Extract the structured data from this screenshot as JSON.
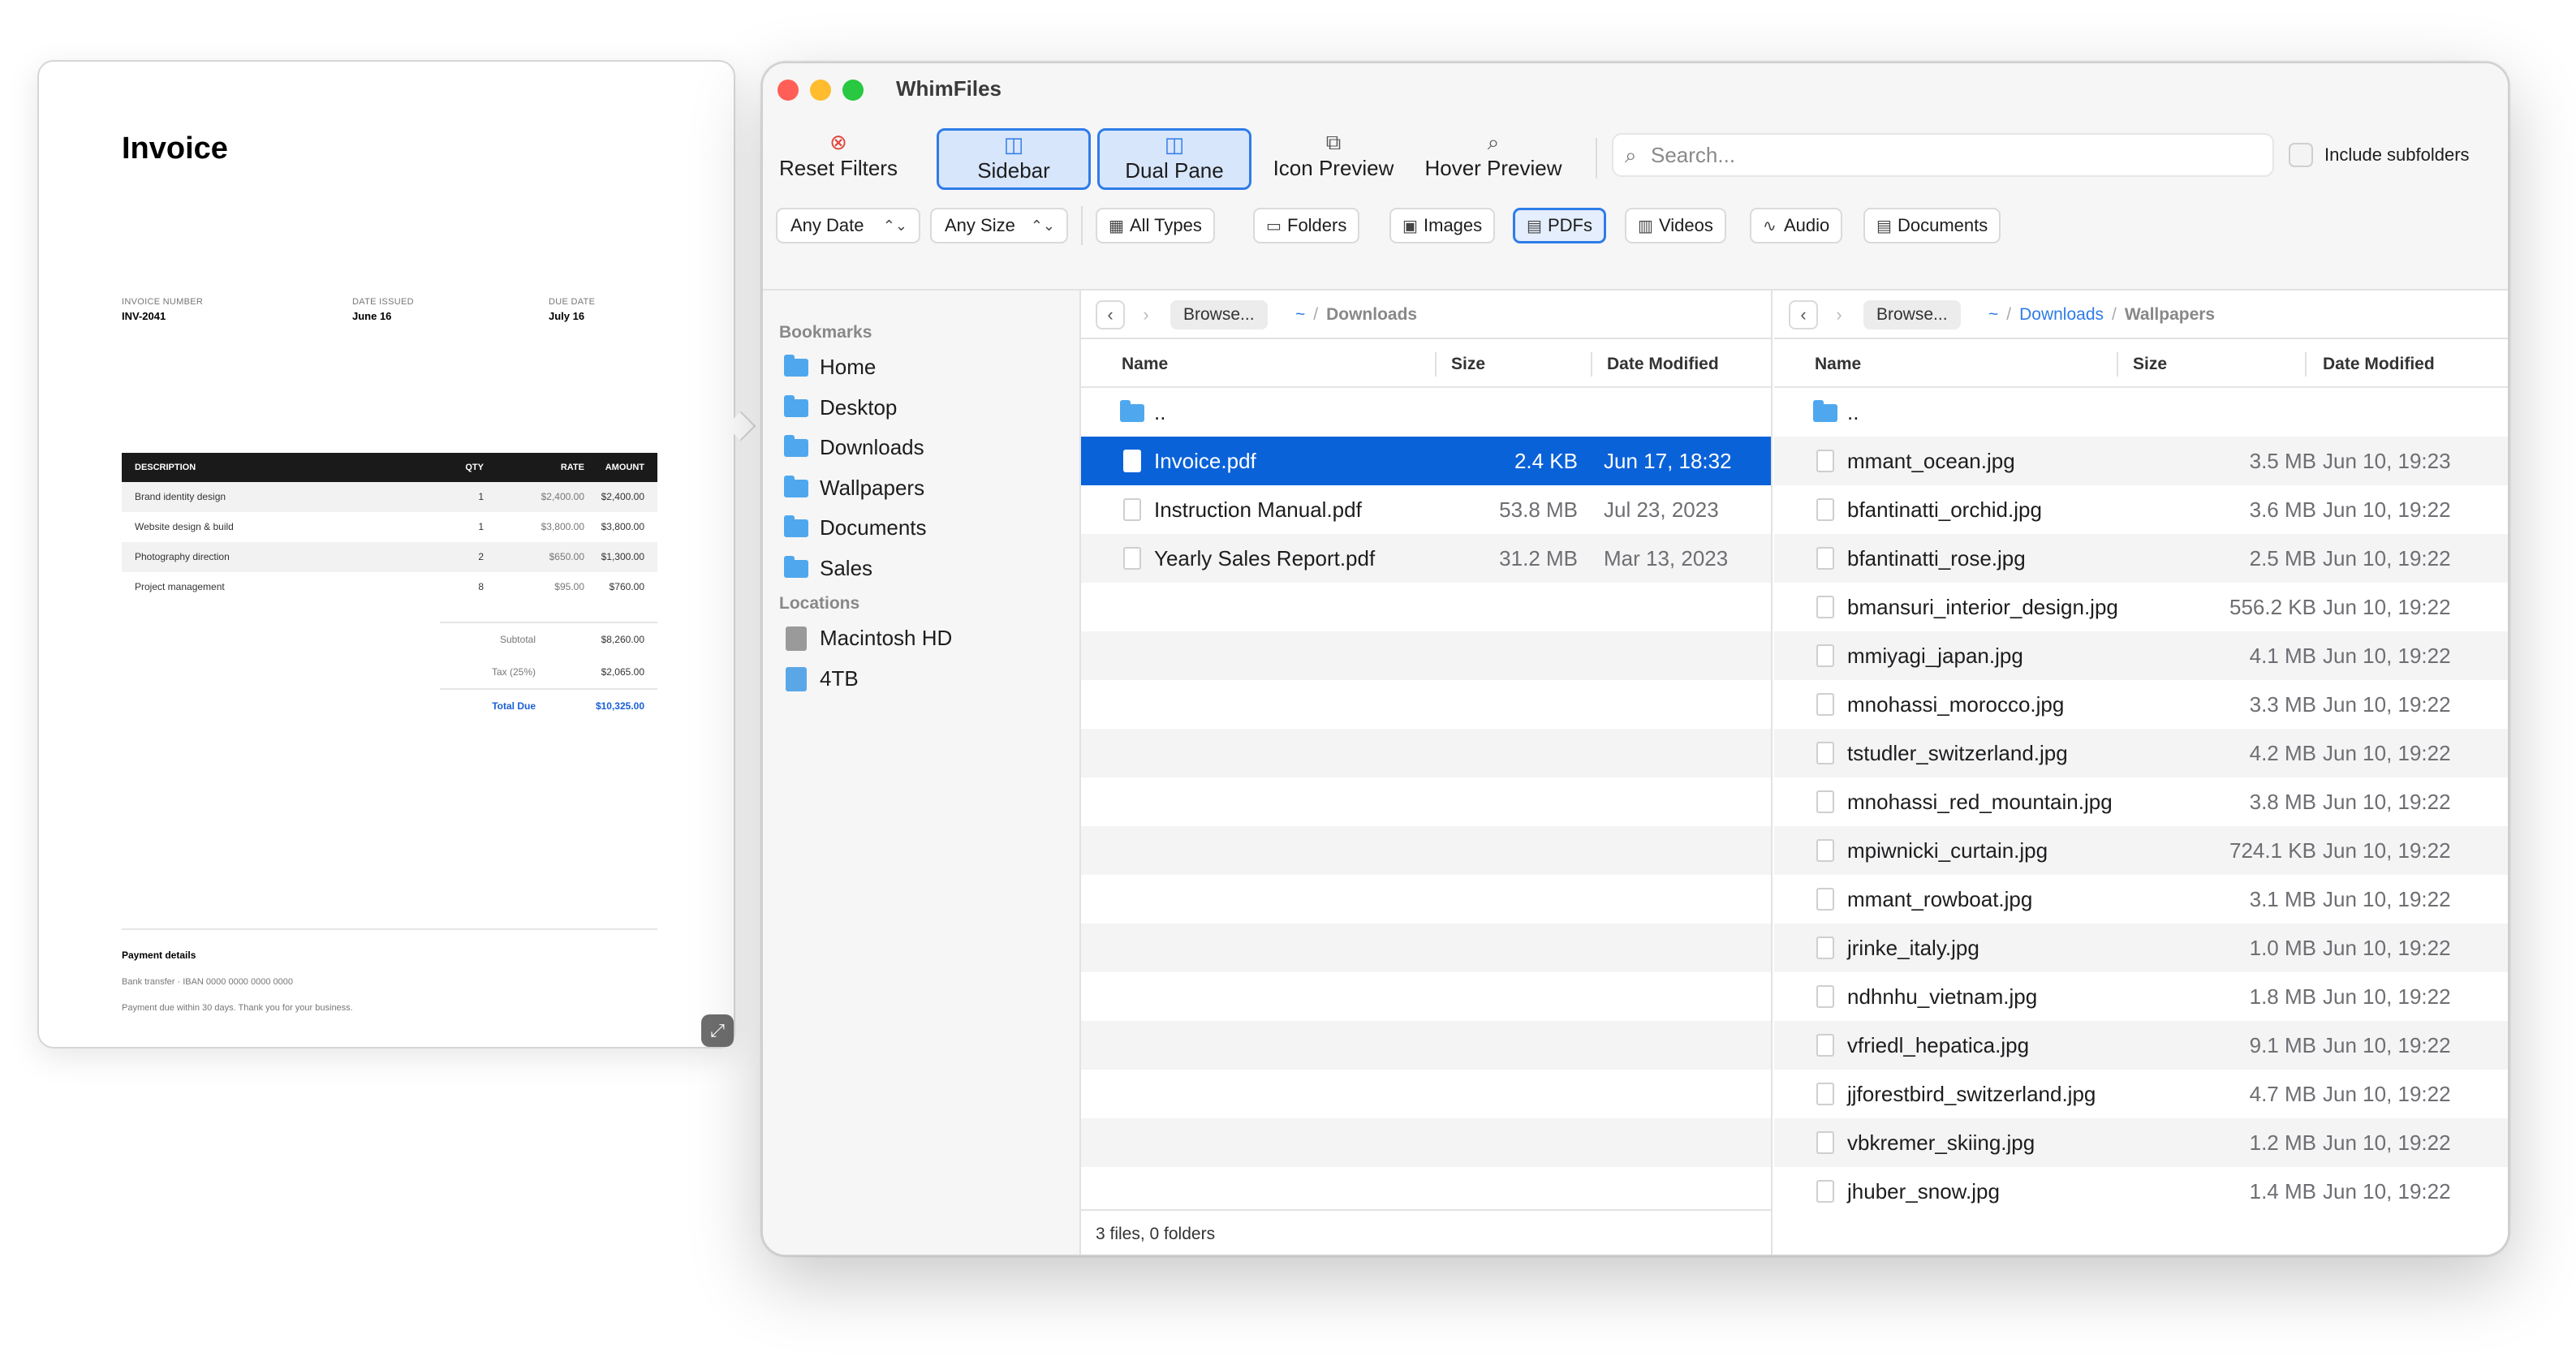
{
  "preview": {
    "title": "Invoice",
    "meta": [
      {
        "label": "INVOICE NUMBER",
        "value": "INV-2041"
      },
      {
        "label": "DATE ISSUED",
        "value": "June 16"
      },
      {
        "label": "DUE DATE",
        "value": "July 16"
      }
    ],
    "table_headers": {
      "desc": "DESCRIPTION",
      "qty": "QTY",
      "rate": "RATE",
      "amount": "AMOUNT"
    },
    "lines": [
      {
        "desc": "Brand identity design",
        "qty": "1",
        "rate": "$2,400.00",
        "amount": "$2,400.00"
      },
      {
        "desc": "Website design & build",
        "qty": "1",
        "rate": "$3,800.00",
        "amount": "$3,800.00"
      },
      {
        "desc": "Photography direction",
        "qty": "2",
        "rate": "$650.00",
        "amount": "$1,300.00"
      },
      {
        "desc": "Project management",
        "qty": "8",
        "rate": "$95.00",
        "amount": "$760.00"
      }
    ],
    "subtotal_label": "Subtotal",
    "subtotal": "$8,260.00",
    "tax_label": "Tax (25%)",
    "tax": "$2,065.00",
    "total_label": "Total Due",
    "total": "$10,325.00",
    "payment_title": "Payment details",
    "payment_line1": "Bank transfer · IBAN 0000 0000 0000 0000",
    "payment_line2": "Payment due within 30 days. Thank you for your business.",
    "expand_icon": "expand-icon"
  },
  "window": {
    "title": "WhimFiles",
    "toolbar": {
      "reset_filters": "Reset Filters",
      "sidebar": "Sidebar",
      "dual_pane": "Dual Pane",
      "icon_preview": "Icon Preview",
      "hover_preview": "Hover Preview"
    },
    "search_placeholder": "Search...",
    "include_subfolders": "Include subfolders",
    "filters": {
      "date": "Any Date",
      "size": "Any Size",
      "types": [
        "All Types",
        "Folders",
        "Images",
        "PDFs",
        "Videos",
        "Audio",
        "Documents"
      ],
      "active_type": "PDFs"
    },
    "accent_color": "#0a62d9"
  },
  "sidebar": {
    "bookmarks_label": "Bookmarks",
    "bookmarks": [
      "Home",
      "Desktop",
      "Downloads",
      "Wallpapers",
      "Documents",
      "Sales"
    ],
    "locations_label": "Locations",
    "locations": [
      "Macintosh HD",
      "4TB"
    ]
  },
  "left_pane": {
    "browse": "Browse...",
    "home": "~",
    "path": [
      "Downloads"
    ],
    "columns": {
      "name": "Name",
      "size": "Size",
      "date": "Date Modified"
    },
    "parent": "..",
    "files": [
      {
        "name": "Invoice.pdf",
        "size": "2.4 KB",
        "date": "Jun 17, 18:32",
        "selected": true
      },
      {
        "name": "Instruction Manual.pdf",
        "size": "53.8 MB",
        "date": "Jul 23, 2023"
      },
      {
        "name": "Yearly Sales Report.pdf",
        "size": "31.2 MB",
        "date": "Mar 13, 2023"
      }
    ],
    "status": "3 files, 0 folders"
  },
  "right_pane": {
    "browse": "Browse...",
    "home": "~",
    "path": [
      "Downloads",
      "Wallpapers"
    ],
    "columns": {
      "name": "Name",
      "size": "Size",
      "date": "Date Modified"
    },
    "parent": "..",
    "files": [
      {
        "name": "mmant_ocean.jpg",
        "size": "3.5 MB",
        "date": "Jun 10, 19:23"
      },
      {
        "name": "bfantinatti_orchid.jpg",
        "size": "3.6 MB",
        "date": "Jun 10, 19:22"
      },
      {
        "name": "bfantinatti_rose.jpg",
        "size": "2.5 MB",
        "date": "Jun 10, 19:22"
      },
      {
        "name": "bmansuri_interior_design.jpg",
        "size": "556.2 KB",
        "date": "Jun 10, 19:22"
      },
      {
        "name": "mmiyagi_japan.jpg",
        "size": "4.1 MB",
        "date": "Jun 10, 19:22"
      },
      {
        "name": "mnohassi_morocco.jpg",
        "size": "3.3 MB",
        "date": "Jun 10, 19:22"
      },
      {
        "name": "tstudler_switzerland.jpg",
        "size": "4.2 MB",
        "date": "Jun 10, 19:22"
      },
      {
        "name": "mnohassi_red_mountain.jpg",
        "size": "3.8 MB",
        "date": "Jun 10, 19:22"
      },
      {
        "name": "mpiwnicki_curtain.jpg",
        "size": "724.1 KB",
        "date": "Jun 10, 19:22"
      },
      {
        "name": "mmant_rowboat.jpg",
        "size": "3.1 MB",
        "date": "Jun 10, 19:22"
      },
      {
        "name": "jrinke_italy.jpg",
        "size": "1.0 MB",
        "date": "Jun 10, 19:22"
      },
      {
        "name": "ndhnhu_vietnam.jpg",
        "size": "1.8 MB",
        "date": "Jun 10, 19:22"
      },
      {
        "name": "vfriedl_hepatica.jpg",
        "size": "9.1 MB",
        "date": "Jun 10, 19:22"
      },
      {
        "name": "jjforestbird_switzerland.jpg",
        "size": "4.7 MB",
        "date": "Jun 10, 19:22"
      },
      {
        "name": "vbkremer_skiing.jpg",
        "size": "1.2 MB",
        "date": "Jun 10, 19:22"
      },
      {
        "name": "jhuber_snow.jpg",
        "size": "1.4 MB",
        "date": "Jun 10, 19:22"
      }
    ]
  }
}
